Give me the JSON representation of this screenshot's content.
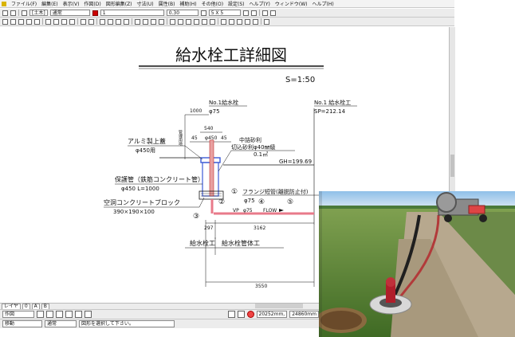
{
  "menu": [
    "ファイル(F)",
    "編集(E)",
    "表示(V)",
    "作図(D)",
    "図形編集(Z)",
    "寸法(U)",
    "属性(B)",
    "補助(H)",
    "その他(O)",
    "設定(S)",
    "ヘルプ(Y)",
    "ウィンドウ(W)",
    "ヘルプ(H)"
  ],
  "toolbar": {
    "layer": "[土木]",
    "linetype": "通常",
    "linewidth": "1",
    "scale": "0.30",
    "grid": "5 X 5"
  },
  "drawing": {
    "title": "給水栓工詳細図",
    "scale": "S=1:50",
    "no1_label": "No.1給水栓",
    "no1_dia": "φ75",
    "no1_right_label": "No.1 給水栓工",
    "sp": "SP=212.14",
    "dim_1000": "1000",
    "dim_540": "540",
    "dim_45a": "45",
    "dim_450": "φ450",
    "dim_45b": "45",
    "vertical_label": "管理用地",
    "alumi_label": "アルミ製上蓋",
    "alumi_spec": "φ450用",
    "sand_label": "中詰砂利",
    "sand_spec": "切込砂利φ40㎜級",
    "sand_vol": "0.1㎥",
    "gh": "GH=199.69",
    "protect_label": "保護管（鉄筋コンクリート管）",
    "protect_spec": "φ450 L=1000",
    "block_label": "空洞コンクリートブロック",
    "block_spec": "390×190×100",
    "flange_label": "フランジ短管(離脱防止付)",
    "flange_dia": "φ75",
    "c1": "①",
    "c2": "②",
    "c3": "③",
    "c4": "④",
    "c5": "⑤",
    "vp": "VP",
    "vp_dia": "φ75",
    "flow": "FLOW",
    "dim_297": "297",
    "dim_3162": "3162",
    "dim_3550": "3550",
    "bottom_left": "給水栓工",
    "bottom_right": "給水栓管体工"
  },
  "tabs": [
    "レイヤ",
    "0",
    "A",
    "B"
  ],
  "bottom1": {
    "mode": "作図",
    "coord_x": "20252mm,",
    "coord_y": "24860mm"
  },
  "bottom2": {
    "snap": "移動",
    "line": "通常",
    "status": "図形を選択して下さい。"
  },
  "colors": {
    "accent_red": "#d03030",
    "pipe_pink": "#e87a8a",
    "cover_blue": "#3c5bd6"
  }
}
